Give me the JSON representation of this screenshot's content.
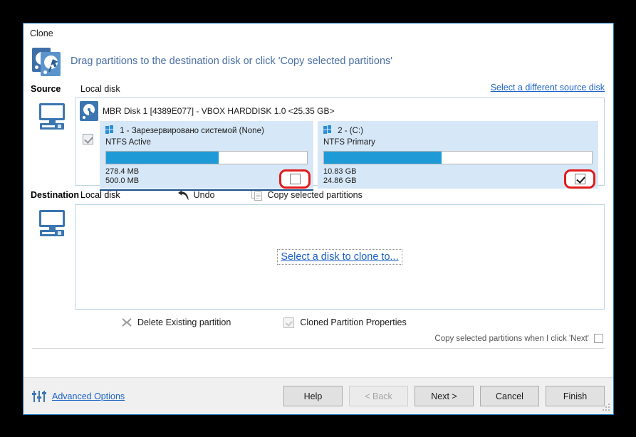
{
  "window": {
    "title": "Clone",
    "banner_text": "Drag partitions to the destination disk or click 'Copy selected partitions'"
  },
  "source": {
    "label": "Source",
    "type": "Local disk",
    "different_disk_link": "Select a different source disk",
    "disk_title": "MBR Disk 1 [4389E077] - VBOX HARDDISK 1.0  <25.35 GB>",
    "partitions": [
      {
        "name": "1 - Зарезервировано системой (None)",
        "filesystem": "NTFS Active",
        "used": "278.4 MB",
        "total": "500.0 MB",
        "fill_percent": 56,
        "selected": false,
        "highlighted": true
      },
      {
        "name": "2 -  (C:)",
        "filesystem": "NTFS Primary",
        "used": "10.83 GB",
        "total": "24.86 GB",
        "fill_percent": 44,
        "selected": true,
        "highlighted": true
      }
    ]
  },
  "destination": {
    "label": "Destination",
    "type": "Local disk",
    "undo_label": "Undo",
    "copy_selected_label": "Copy selected partitions",
    "select_disk_link": "Select a disk to clone to..."
  },
  "actions": {
    "delete_existing": "Delete Existing partition",
    "cloned_properties": "Cloned Partition Properties",
    "copy_on_next": "Copy selected partitions when I click 'Next'",
    "copy_on_next_checked": false
  },
  "footer": {
    "advanced_options": "Advanced Options",
    "buttons": [
      {
        "label": "Help",
        "disabled": false
      },
      {
        "label": "< Back",
        "disabled": true
      },
      {
        "label": "Next >",
        "disabled": false
      },
      {
        "label": "Cancel",
        "disabled": false
      },
      {
        "label": "Finish",
        "disabled": false
      }
    ]
  },
  "colors": {
    "accent_blue": "#1e9bd7",
    "link_blue": "#1a61c7",
    "panel_blue": "#d6e7f7",
    "highlight_red": "#e21b1b",
    "window_border": "#1674b8"
  }
}
